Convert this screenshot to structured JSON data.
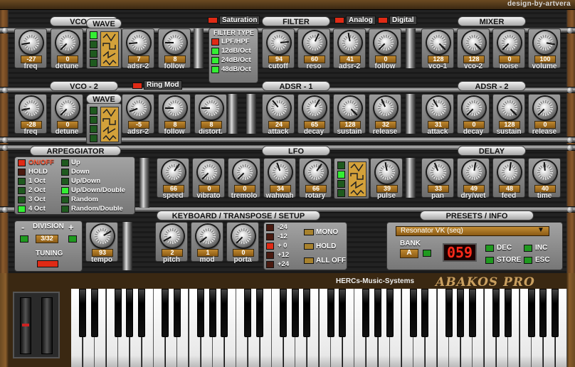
{
  "credit": "design-by-artvera",
  "vco1": {
    "title": "VCO - 1",
    "wave_title": "WAVE",
    "controls": [
      {
        "label": "freq",
        "value": "-27"
      },
      {
        "label": "detune",
        "value": "0"
      },
      {
        "label": "adsr-2",
        "value": "7"
      },
      {
        "label": "follow",
        "value": "8"
      }
    ]
  },
  "vco2": {
    "title": "VCO - 2",
    "wave_title": "WAVE",
    "ring_mod": "Ring Mod",
    "controls": [
      {
        "label": "freq",
        "value": "-28"
      },
      {
        "label": "detune",
        "value": "0"
      },
      {
        "label": "adsr-2",
        "value": "-5"
      },
      {
        "label": "follow",
        "value": "8"
      },
      {
        "label": "distort.",
        "value": "8"
      }
    ]
  },
  "saturation": "Saturation",
  "filter": {
    "title": "FILTER",
    "analog": "Analog",
    "digital": "Digital",
    "type_title": "FILTER TYPE",
    "types": [
      "LPF/HPF",
      "12dB/Oct",
      "24dB/Oct",
      "48dB/Oct"
    ],
    "controls": [
      {
        "label": "cutoff",
        "value": "94"
      },
      {
        "label": "reso",
        "value": "60"
      },
      {
        "label": "adsr-2",
        "value": "41"
      },
      {
        "label": "follow",
        "value": "0"
      }
    ]
  },
  "mixer": {
    "title": "MIXER",
    "controls": [
      {
        "label": "vco-1",
        "value": "128"
      },
      {
        "label": "vco-2",
        "value": "128"
      },
      {
        "label": "noise",
        "value": "0"
      },
      {
        "label": "volume",
        "value": "100"
      }
    ]
  },
  "adsr1": {
    "title": "ADSR - 1",
    "controls": [
      {
        "label": "attack",
        "value": "24"
      },
      {
        "label": "decay",
        "value": "65"
      },
      {
        "label": "sustain",
        "value": "128"
      },
      {
        "label": "release",
        "value": "32"
      }
    ]
  },
  "adsr2": {
    "title": "ADSR - 2",
    "controls": [
      {
        "label": "attack",
        "value": "31"
      },
      {
        "label": "decay",
        "value": "0"
      },
      {
        "label": "sustain",
        "value": "128"
      },
      {
        "label": "release",
        "value": "0"
      }
    ]
  },
  "arp": {
    "title": "ARPEGGIATOR",
    "left": [
      "ON/OFF",
      "HOLD",
      "1 Oct",
      "2 Oct",
      "3 Oct",
      "4 Oct"
    ],
    "right": [
      "Up",
      "Down",
      "Up/Down",
      "Up/Down/Double",
      "Random",
      "Random/Double"
    ]
  },
  "lfo": {
    "title": "LFO",
    "controls": [
      {
        "label": "speed",
        "value": "66"
      },
      {
        "label": "vibrato",
        "value": "0"
      },
      {
        "label": "tremolo",
        "value": "0"
      },
      {
        "label": "wahwah",
        "value": "34"
      },
      {
        "label": "rotary",
        "value": "66"
      },
      {
        "label": "pulse",
        "value": "39"
      }
    ]
  },
  "delay": {
    "title": "DELAY",
    "controls": [
      {
        "label": "pan",
        "value": "33"
      },
      {
        "label": "dry/wet",
        "value": "49"
      },
      {
        "label": "feed",
        "value": "48"
      },
      {
        "label": "time",
        "value": "40"
      }
    ]
  },
  "division": {
    "title": "DIVISION",
    "minus": "-",
    "plus": "+",
    "value": "3/32",
    "tuning": "TUNING"
  },
  "tempo": {
    "label": "tempo",
    "value": "93"
  },
  "keyboard": {
    "title": "KEYBOARD / TRANSPOSE / SETUP",
    "controls": [
      {
        "label": "pitch",
        "value": "2"
      },
      {
        "label": "mod",
        "value": "1"
      },
      {
        "label": "porta",
        "value": "0"
      }
    ],
    "transpose": [
      "-24",
      "-12",
      "+ 0",
      "+12",
      "+24"
    ],
    "mono": "MONO",
    "hold": "HOLD",
    "alloff": "ALL OFF"
  },
  "presets": {
    "title": "PRESETS / INFO",
    "preset": "Resonator VK (seq)",
    "bank_label": "BANK",
    "bank": "A",
    "number": "059",
    "dec": "DEC",
    "inc": "INC",
    "store": "STORE",
    "esc": "ESC"
  },
  "footer": {
    "company": "HERCs-Music-Systems",
    "product": "ABAKOS PRO"
  }
}
